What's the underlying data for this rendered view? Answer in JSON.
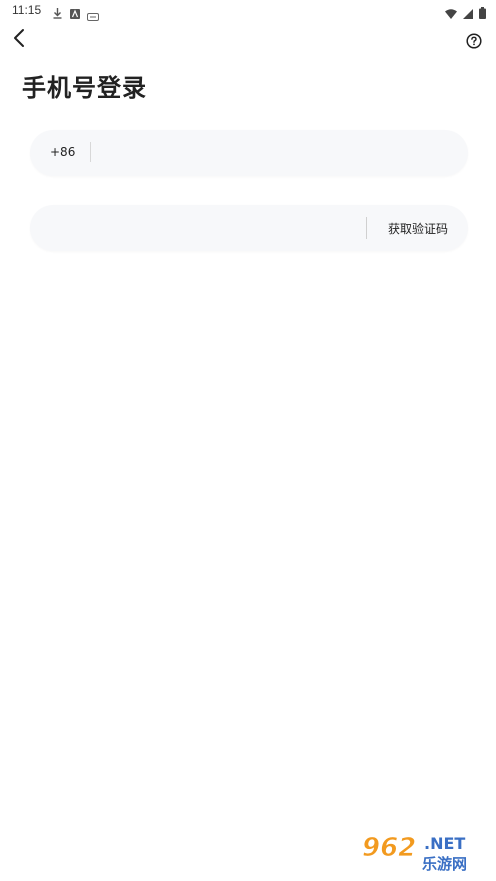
{
  "status_bar": {
    "time": "11:15"
  },
  "header": {
    "title": "手机号登录"
  },
  "phone_field": {
    "country_code": "+86",
    "value": "",
    "placeholder": ""
  },
  "code_field": {
    "value": "",
    "placeholder": "",
    "get_code_label": "获取验证码"
  },
  "watermark": {
    "brand_number": "962",
    "brand_suffix": ".NET",
    "brand_text": "乐游网"
  },
  "colors": {
    "input_background": "#f7f8fa",
    "text_primary": "#222222",
    "watermark_orange": "#f29a1f",
    "watermark_blue": "#3a6fc4"
  }
}
